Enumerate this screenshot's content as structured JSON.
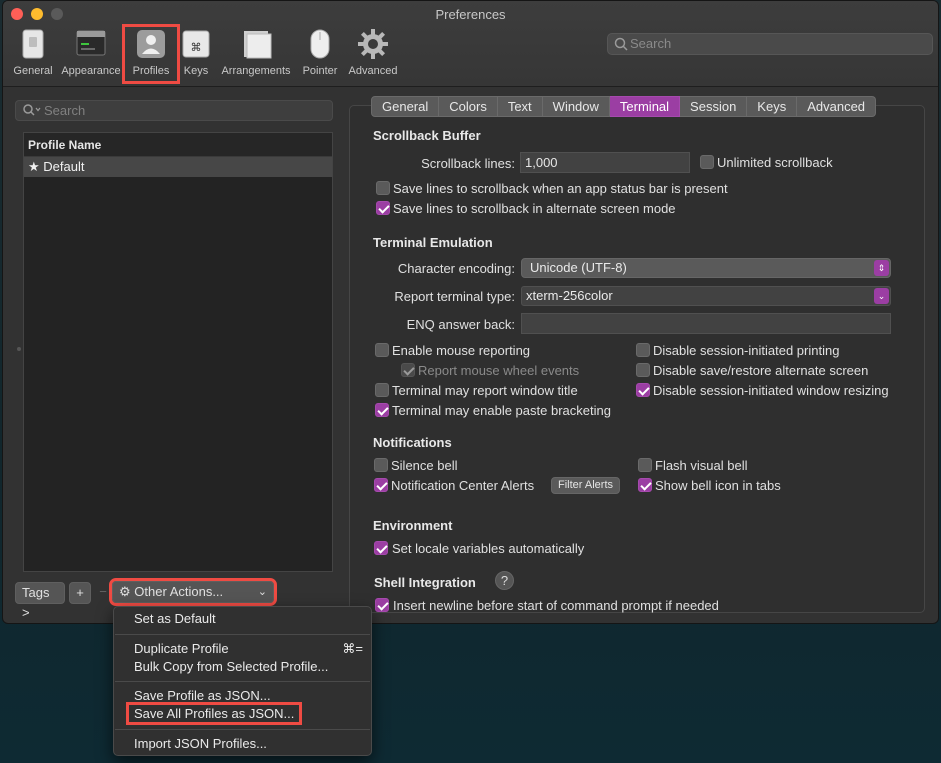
{
  "window": {
    "title": "Preferences"
  },
  "toolbar": {
    "items": [
      {
        "label": "General",
        "icon": "general-icon"
      },
      {
        "label": "Appearance",
        "icon": "appearance-icon"
      },
      {
        "label": "Profiles",
        "icon": "profiles-icon"
      },
      {
        "label": "Keys",
        "icon": "keys-icon"
      },
      {
        "label": "Arrangements",
        "icon": "arrangements-icon"
      },
      {
        "label": "Pointer",
        "icon": "pointer-icon"
      },
      {
        "label": "Advanced",
        "icon": "gear-icon"
      }
    ],
    "search_placeholder": "Search"
  },
  "sidebar": {
    "search_placeholder": "Search",
    "list_header": "Profile Name",
    "profiles": [
      {
        "name": "Default",
        "is_default": true
      }
    ],
    "tags_label": "Tags >",
    "add_label": "+",
    "remove_label": "−",
    "other_actions_label": "Other Actions..."
  },
  "tabs": [
    "General",
    "Colors",
    "Text",
    "Window",
    "Terminal",
    "Session",
    "Keys",
    "Advanced"
  ],
  "active_tab": "Terminal",
  "terminal": {
    "scrollback": {
      "title": "Scrollback Buffer",
      "lines_label": "Scrollback lines:",
      "lines_value": "1,000",
      "unlimited_label": "Unlimited scrollback",
      "unlimited": false,
      "status_bar_label": "Save lines to scrollback when an app status bar is present",
      "status_bar": false,
      "alt_screen_label": "Save lines to scrollback in alternate screen mode",
      "alt_screen": true
    },
    "emulation": {
      "title": "Terminal Emulation",
      "encoding_label": "Character encoding:",
      "encoding_value": "Unicode (UTF-8)",
      "report_type_label": "Report terminal type:",
      "report_type_value": "xterm-256color",
      "enq_label": "ENQ answer back:",
      "enq_value": "",
      "mouse_reporting_label": "Enable mouse reporting",
      "mouse_reporting": false,
      "wheel_events_label": "Report mouse wheel events",
      "wheel_events": true,
      "window_title_label": "Terminal may report window title",
      "window_title": false,
      "paste_bracketing_label": "Terminal may enable paste bracketing",
      "paste_bracketing": true,
      "disable_printing_label": "Disable session-initiated printing",
      "disable_printing": false,
      "disable_alt_screen_label": "Disable save/restore alternate screen",
      "disable_alt_screen": false,
      "disable_resizing_label": "Disable session-initiated window resizing",
      "disable_resizing": true
    },
    "notifications": {
      "title": "Notifications",
      "silence_bell_label": "Silence bell",
      "silence_bell": false,
      "flash_bell_label": "Flash visual bell",
      "flash_bell": false,
      "nc_alerts_label": "Notification Center Alerts",
      "nc_alerts": true,
      "filter_alerts_label": "Filter Alerts",
      "bell_icon_label": "Show bell icon in tabs",
      "bell_icon": true
    },
    "environment": {
      "title": "Environment",
      "locale_label": "Set locale variables automatically",
      "locale": true
    },
    "shell_integration": {
      "title": "Shell Integration",
      "help_label": "?",
      "newline_label": "Insert newline before start of command prompt if needed",
      "newline": true
    }
  },
  "menu": {
    "set_default": "Set as Default",
    "duplicate": "Duplicate Profile",
    "duplicate_shortcut": "⌘=",
    "bulk_copy": "Bulk Copy from Selected Profile...",
    "save_json": "Save Profile as JSON...",
    "save_all_json": "Save All Profiles as JSON...",
    "import_json": "Import JSON Profiles..."
  },
  "colors": {
    "accent": "#9b3ea3",
    "highlight_box": "#ef4b43"
  }
}
